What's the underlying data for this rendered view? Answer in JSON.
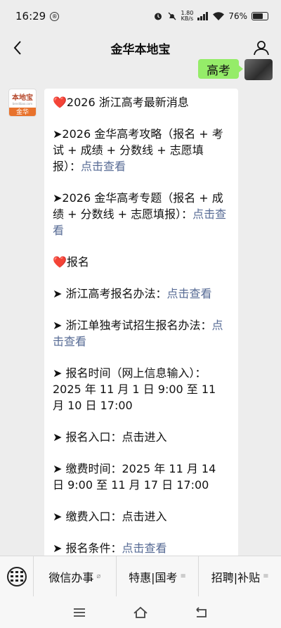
{
  "status": {
    "time": "16:29",
    "speed_top": "1.80",
    "speed_unit": "KB/s",
    "battery": "76%",
    "battery_level": 0.76
  },
  "nav": {
    "title": "金华本地宝"
  },
  "sent": {
    "text": "高考"
  },
  "account": {
    "logo_name": "本地宝",
    "logo_url": "bendibao.com",
    "logo_city": "金华"
  },
  "message": {
    "p1": "2026 浙江高考最新消息",
    "p2_text": "➤2026 金华高考攻略（报名 + 考试 + 成绩 + 分数线 + 志愿填报）：",
    "p2_link": "点击查看",
    "p3_text": "➤2026 金华高考专题（报名 + 成绩 + 分数线 + 志愿填报）：",
    "p3_link": "点击查看",
    "p4": "报名",
    "p5_text": "➤ 浙江高考报名办法：",
    "p5_link": "点击查看",
    "p6_text": "➤ 浙江单独考试招生报名办法：",
    "p6_link": "点击查看",
    "p7": "➤ 报名时间（网上信息输入）：2025 年 11 月 1 日 9:00 至 11 月 10 日 17:00",
    "p8": "➤ 报名入口：点击进入",
    "p9": "➤ 缴费时间：2025 年 11 月 14 日 9:00 至 11 月 17 日 17:00",
    "p10": "➤ 缴费入口：点击进入",
    "p11_text": "➤ 报名条件：",
    "p11_link": "点击查看"
  },
  "menu": {
    "item1": "微信办事",
    "item2": "特惠|国考",
    "item3": "招聘|补贴"
  }
}
